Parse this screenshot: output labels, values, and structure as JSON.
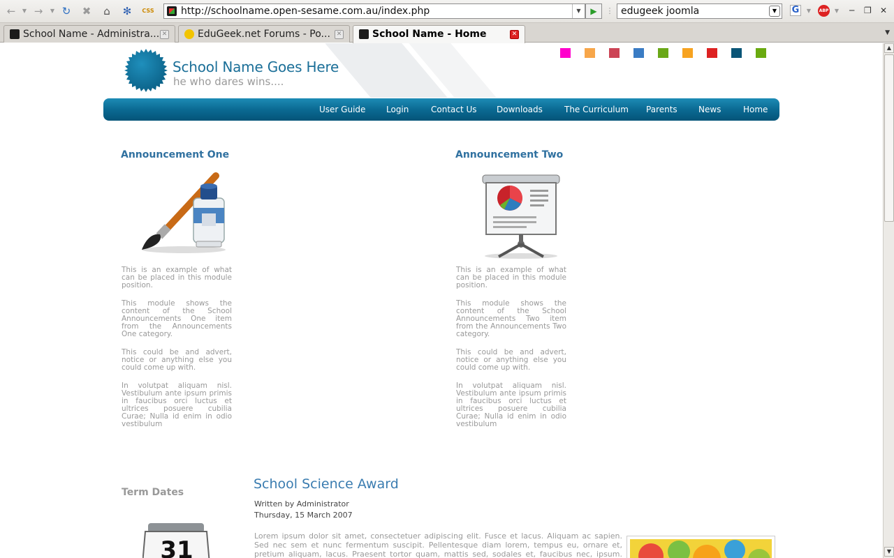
{
  "browser": {
    "url": "http://schoolname.open-sesame.com.au/index.php",
    "search_text": "edugeek joomla",
    "tabs": [
      {
        "title": "School Name - Administra...",
        "active": false
      },
      {
        "title": "EduGeek.net Forums - Po...",
        "active": false
      },
      {
        "title": "School Name - Home",
        "active": true
      }
    ]
  },
  "site": {
    "title": "School Name Goes Here",
    "slogan": "he who dares wins....",
    "swatches": [
      "#ff00cc",
      "#f7a64a",
      "#cc4455",
      "#3a7cc4",
      "#6aa818",
      "#f7a320",
      "#dd2222",
      "#0a5577",
      "#6aaa10"
    ],
    "nav": [
      "User Guide",
      "Login",
      "Contact Us",
      "Downloads",
      "The Curriculum",
      "Parents",
      "News",
      "Home"
    ]
  },
  "announcements": [
    {
      "title": "Announcement One",
      "icon": "paint-brush-icon",
      "paragraphs": [
        "This is an example of what can be placed in this module position.",
        "This module shows the content of the School Announcements One item from the Announcements One category.",
        "This could be and advert, notice or anything else you could come up with.",
        "In volutpat aliquam nisl. Vestibulum ante ipsum primis in faucibus orci luctus et ultrices posuere cubilia Curae; Nulla id enim in odio vestibulum"
      ]
    },
    {
      "title": "Announcement Two",
      "icon": "presentation-icon",
      "paragraphs": [
        "This is an example of what can be placed in this module position.",
        "This module shows the content of the School Announcements Two item from the Announcements Two category.",
        "This could be and advert, notice or anything else you could come up with.",
        "In volutpat aliquam nisl. Vestibulum ante ipsum primis in faucibus orci luctus et ultrices posuere cubilia Curae; Nulla id enim in odio vestibulum"
      ]
    }
  ],
  "term_dates": {
    "title": "Term Dates",
    "calendar_day": "31"
  },
  "article": {
    "title": "School Science Award",
    "author": "Written by Administrator",
    "date": "Thursday, 15 March 2007",
    "body": "Lorem ipsum dolor sit amet, consectetuer adipiscing elit. Fusce et lacus. Aliquam ac sapien. Sed nec sem et nunc fermentum suscipit. Pellentesque diam lorem, tempus eu, ornare et, pretium aliquam, lacus. Praesent tortor quam, mattis sed, sodales et, faucibus nec, ipsum. Aliquam erat volutpat."
  }
}
